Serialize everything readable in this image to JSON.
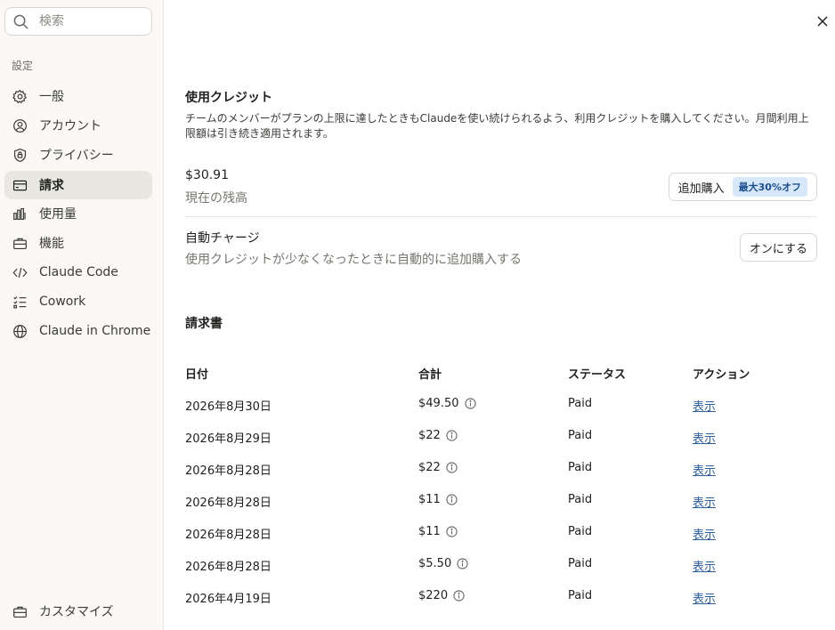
{
  "sidebar": {
    "search_placeholder": "検索",
    "section_label": "設定",
    "items": [
      {
        "label": "一般",
        "icon": "gear-icon"
      },
      {
        "label": "アカウント",
        "icon": "user-circle-icon"
      },
      {
        "label": "プライバシー",
        "icon": "shield-icon"
      },
      {
        "label": "請求",
        "icon": "credit-card-icon",
        "active": true
      },
      {
        "label": "使用量",
        "icon": "bar-chart-icon"
      },
      {
        "label": "機能",
        "icon": "toolbox-icon"
      },
      {
        "label": "Claude Code",
        "icon": "code-icon"
      },
      {
        "label": "Cowork",
        "icon": "checklist-icon"
      },
      {
        "label": "Claude in Chrome",
        "icon": "globe-icon"
      }
    ],
    "customize_label": "カスタマイズ"
  },
  "credits": {
    "title": "使用クレジット",
    "description": "チームのメンバーがプランの上限に達したときもClaudeを使い続けられるよう、利用クレジットを購入してください。月間利用上限額は引き続き適用されます。",
    "balance_value": "$30.91",
    "balance_label": "現在の残高",
    "buy_button_label": "追加購入",
    "buy_badge": "最大30%オフ",
    "auto_charge_title": "自動チャージ",
    "auto_charge_description": "使用クレジットが少なくなったときに自動的に追加購入する",
    "auto_charge_button": "オンにする"
  },
  "invoices": {
    "title": "請求書",
    "columns": [
      "日付",
      "合計",
      "ステータス",
      "アクション"
    ],
    "rows": [
      {
        "date": "2026年8月30日",
        "total": "$49.50",
        "status": "Paid",
        "action": "表示"
      },
      {
        "date": "2026年8月29日",
        "total": "$22",
        "status": "Paid",
        "action": "表示"
      },
      {
        "date": "2026年8月28日",
        "total": "$22",
        "status": "Paid",
        "action": "表示"
      },
      {
        "date": "2026年8月28日",
        "total": "$11",
        "status": "Paid",
        "action": "表示"
      },
      {
        "date": "2026年8月28日",
        "total": "$11",
        "status": "Paid",
        "action": "表示"
      },
      {
        "date": "2026年8月28日",
        "total": "$5.50",
        "status": "Paid",
        "action": "表示"
      },
      {
        "date": "2026年4月19日",
        "total": "$220",
        "status": "Paid",
        "action": "表示"
      }
    ]
  },
  "colors": {
    "sidebar_bg": "#faf9f5",
    "active_item_bg": "#e9e7e1",
    "link": "#2c5f9e",
    "badge_bg": "#d7e8fb"
  }
}
